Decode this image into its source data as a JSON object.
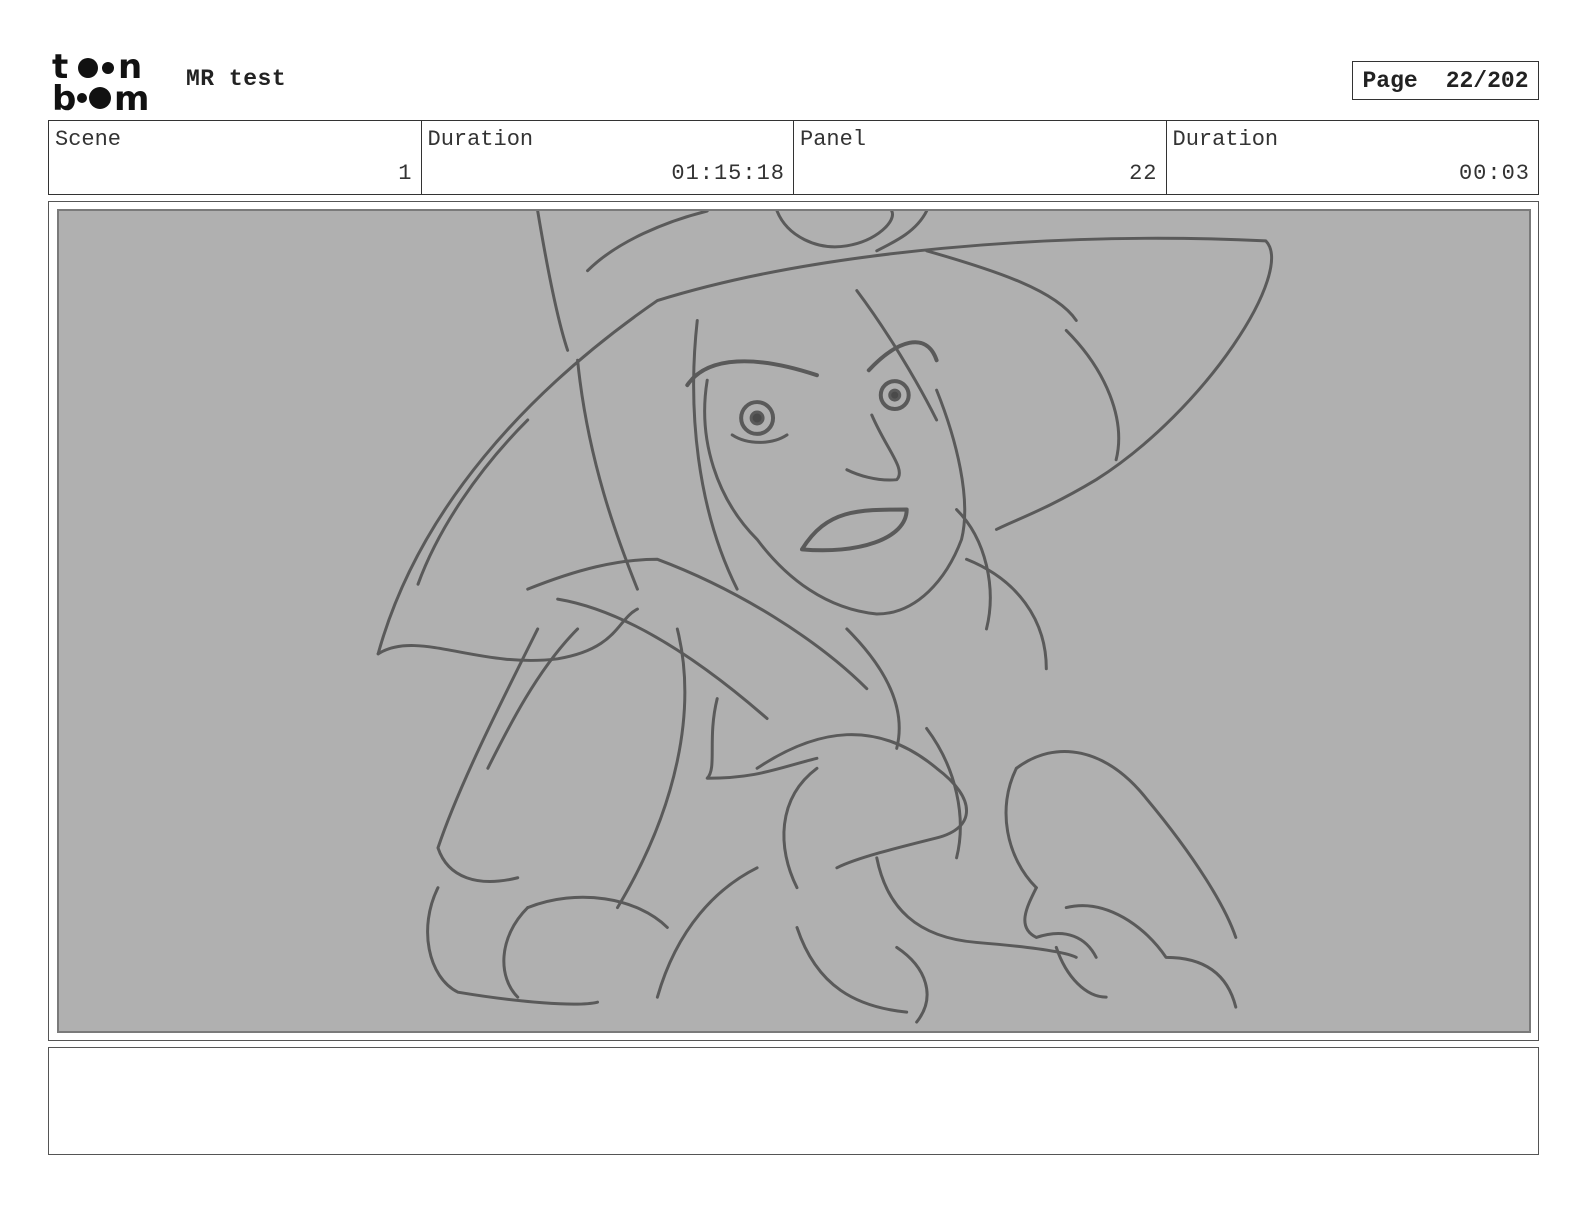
{
  "header": {
    "logo_text": "toon boom",
    "project_title": "MR test",
    "page_label": "Page",
    "page_number": "22/202"
  },
  "info": [
    {
      "label": "Scene",
      "value": "1"
    },
    {
      "label": "Duration",
      "value": "01:15:18"
    },
    {
      "label": "Panel",
      "value": "22"
    },
    {
      "label": "Duration",
      "value": "00:03"
    }
  ],
  "panel": {
    "background_color": "#b0b0b0",
    "sketch_color": "#555555"
  },
  "notes": {
    "text": ""
  }
}
